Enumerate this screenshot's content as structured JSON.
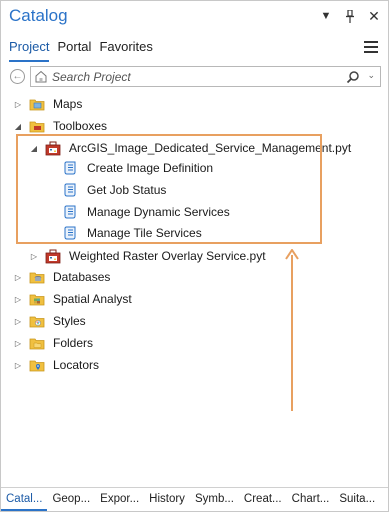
{
  "window": {
    "title": "Catalog"
  },
  "nav": {
    "tabs": [
      {
        "label": "Project"
      },
      {
        "label": "Portal"
      },
      {
        "label": "Favorites"
      }
    ]
  },
  "search": {
    "placeholder": "Search Project"
  },
  "tree": {
    "maps": "Maps",
    "toolboxes": "Toolboxes",
    "toolbox1": "ArcGIS_Image_Dedicated_Service_Management.pyt",
    "tools": [
      "Create Image Definition",
      "Get Job Status",
      "Manage Dynamic Services",
      "Manage Tile Services"
    ],
    "toolbox2": "Weighted Raster Overlay Service.pyt",
    "databases": "Databases",
    "spatial_analyst": "Spatial Analyst",
    "styles": "Styles",
    "folders": "Folders",
    "locators": "Locators"
  },
  "bottom_tabs": [
    "Catal...",
    "Geop...",
    "Expor...",
    "History",
    "Symb...",
    "Creat...",
    "Chart...",
    "Suita..."
  ],
  "colors": {
    "accent": "#2b73c8",
    "highlight": "#e8a060",
    "folder": "#f0c040"
  }
}
